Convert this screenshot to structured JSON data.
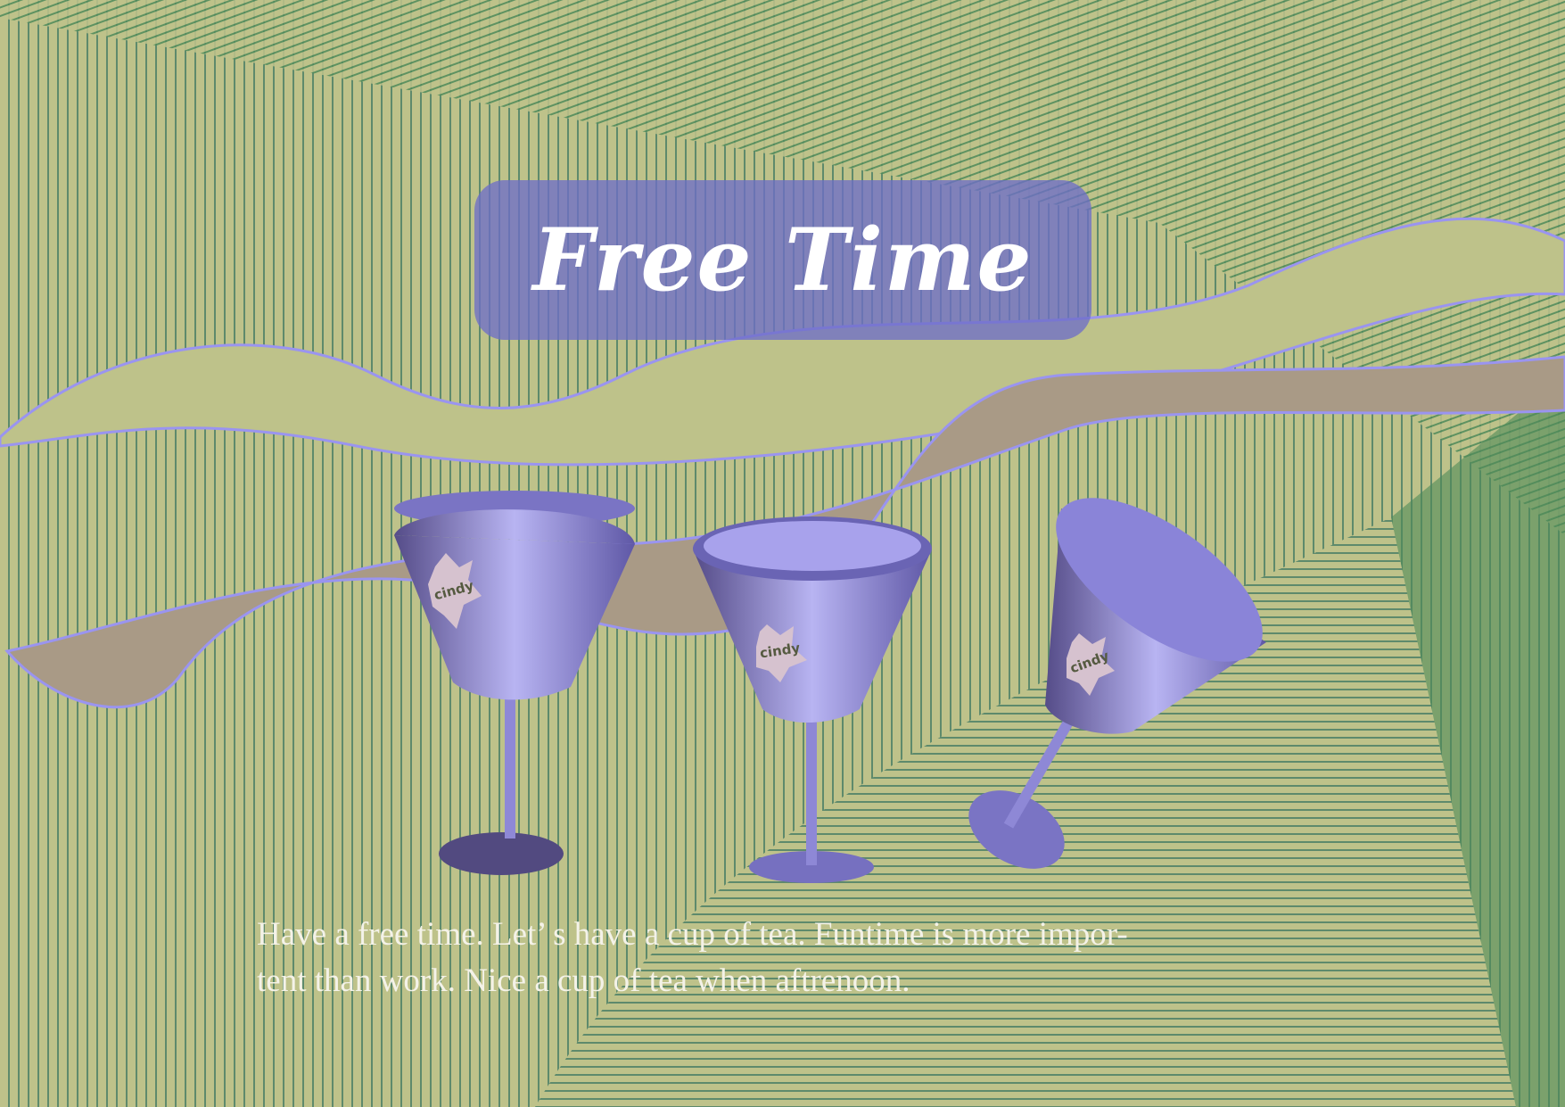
{
  "title": "Free Time",
  "caption": {
    "line1": "Have a free time. Let’ s have a cup of tea. Funtime is more impor-",
    "line2": "tent than work. Nice a cup of tea when aftrenoon."
  },
  "cup_label": "cindy",
  "colors": {
    "background": "#bec28a",
    "stripes": "#5e8a6c",
    "cup": "#7a74c4",
    "title_box": "#6e6ec8",
    "band": "#a99a86"
  }
}
